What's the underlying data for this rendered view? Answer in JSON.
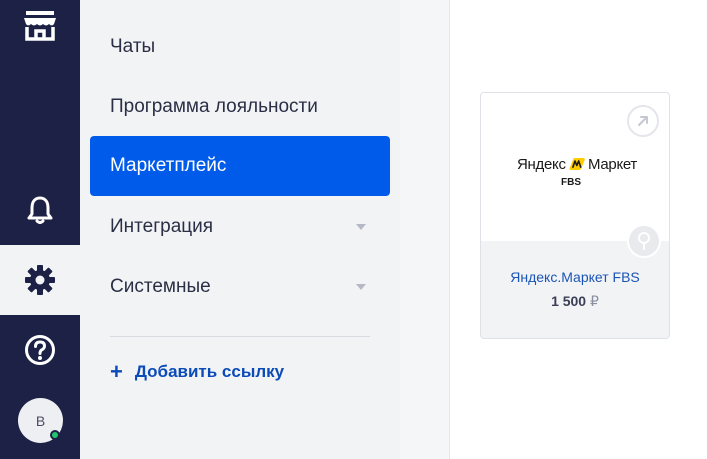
{
  "rail": {
    "avatar_initial": "В",
    "colors": {
      "background": "#1c2145",
      "active": "#f2f3f5",
      "online": "#22c46e"
    },
    "icons": [
      "store-icon",
      "bell-icon",
      "gear-icon",
      "help-icon"
    ]
  },
  "menu": {
    "items": [
      {
        "label": "Чаты",
        "active": false,
        "expandable": false
      },
      {
        "label": "Программа лояльности",
        "active": false,
        "expandable": false
      },
      {
        "label": "Маркетплейс",
        "active": true,
        "expandable": false
      },
      {
        "label": "Интеграция",
        "active": false,
        "expandable": true
      },
      {
        "label": "Системные",
        "active": false,
        "expandable": true
      }
    ],
    "add_link": "Добавить ссылку",
    "add_symbol": "+",
    "accent": "#005bea"
  },
  "card": {
    "logo_word_left": "Яндекс",
    "logo_word_right": "Маркет",
    "logo_sub": "FBS",
    "name": "Яндекс.Маркет FBS",
    "price": "1 500",
    "currency": "₽"
  }
}
